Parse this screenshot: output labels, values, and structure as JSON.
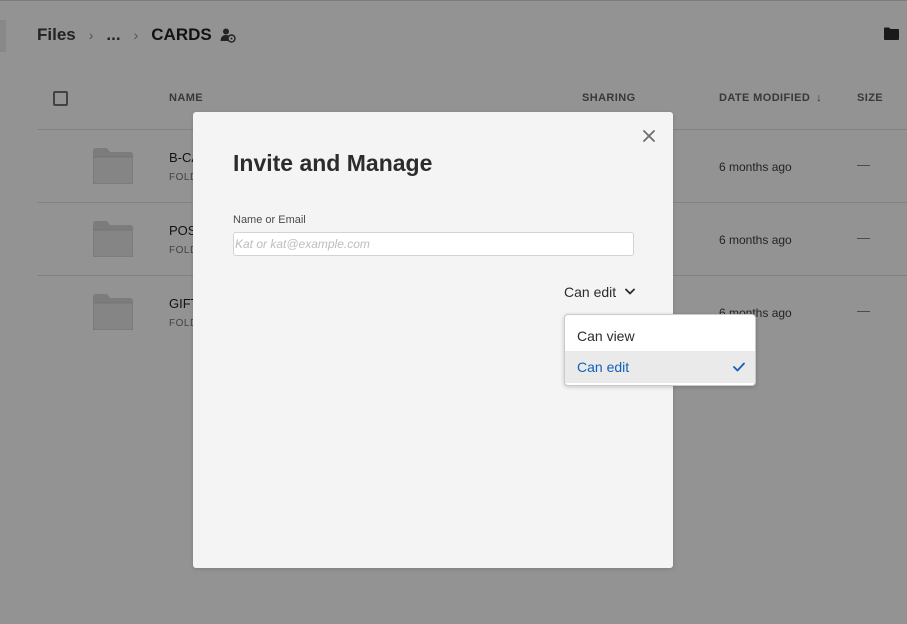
{
  "breadcrumb": {
    "root": "Files",
    "ellipsis": "...",
    "current": "CARDS"
  },
  "table": {
    "headers": {
      "name": "NAME",
      "sharing": "SHARING",
      "date_modified": "DATE MODIFIED",
      "sort_indicator": "↓",
      "size": "SIZE"
    },
    "rows": [
      {
        "name": "B-CA",
        "kind": "FOLD",
        "date": "6 months ago",
        "size": "—"
      },
      {
        "name": "POS",
        "kind": "FOLD",
        "date": "6 months ago",
        "size": "—"
      },
      {
        "name": "GIFT",
        "kind": "FOLD",
        "date": "6 months ago",
        "size": "—"
      }
    ]
  },
  "modal": {
    "title": "Invite and Manage",
    "field_label": "Name or Email",
    "field_placeholder": "Kat or kat@example.com",
    "field_value": "",
    "permission_selected": "Can edit",
    "permission_options": [
      "Can view",
      "Can edit"
    ]
  },
  "icons": {
    "share_user": "user-share-icon",
    "folder": "folder-icon",
    "close": "close-icon",
    "chevron": "chevron-down-icon",
    "checkmark": "checkmark-icon"
  },
  "colors": {
    "accent": "#1361b8",
    "overlay": "#999999",
    "modal_bg": "#f4f4f4"
  }
}
